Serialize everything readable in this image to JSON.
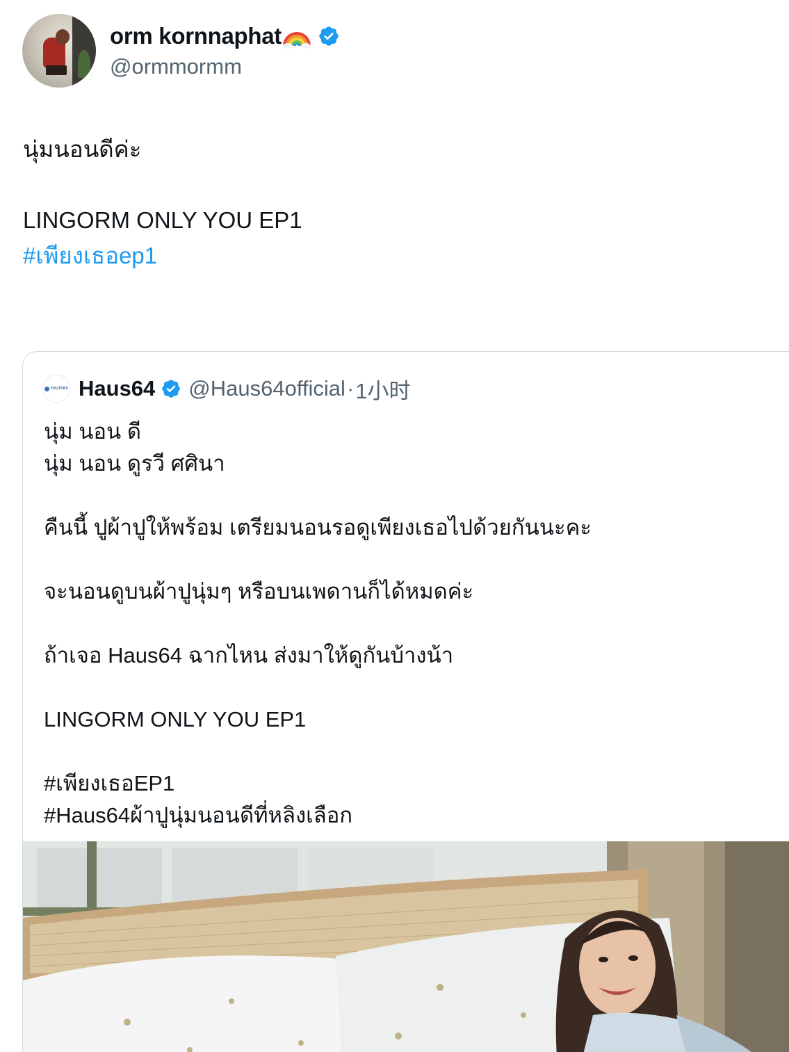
{
  "author": {
    "display_name": "orm kornnaphat",
    "handle": "@ormmormm",
    "name_emoji": "rainbow-emoji",
    "verified_color": "#1d9bf0"
  },
  "tweet": {
    "lines": [
      "นุ่มนอนดีค่ะ",
      "LINGORM ONLY YOU EP1"
    ],
    "hashtag": "#เพียงเธอep1"
  },
  "quoted_tweet": {
    "avatar_text": "HAUS64",
    "display_name": "Haus64",
    "handle": "@Haus64official",
    "separator": "·",
    "time": "1小时",
    "lines": [
      "นุ่ม นอน ดี",
      "นุ่ม นอน ดูรวี ศศินา",
      "คืนนี้ ปูผ้าปูให้พร้อม เตรียมนอนรอดูเพียงเธอไปด้วยกันนะคะ",
      "จะนอนดูบนผ้าปูนุ่มๆ หรือบนเพดานก็ได้หมดค่ะ",
      "ถ้าเจอ Haus64 ฉากไหน ส่งมาให้ดูกันบ้างน้า",
      "LINGORM ONLY YOU EP1",
      "#เพียงเธอEP1",
      "#Haus64ผ้าปูนุ่มนอนดีที่หลิงเลือก"
    ],
    "media": "photo-woman-on-bed"
  },
  "colors": {
    "link": "#1d9bf0",
    "secondary_text": "#536471",
    "border": "#cfd9de"
  }
}
